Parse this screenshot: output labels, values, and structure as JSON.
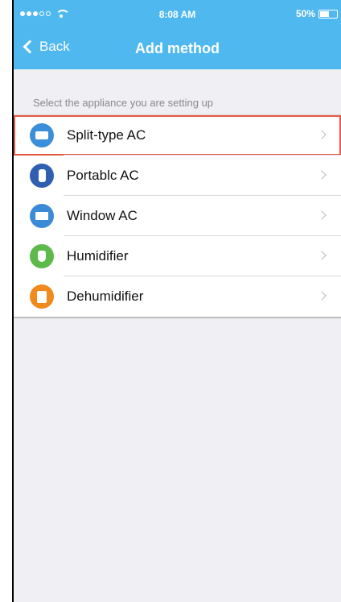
{
  "status_bar": {
    "time": "8:08 AM",
    "battery": "50%",
    "battery_level": 0.5
  },
  "nav": {
    "back_label": "Back",
    "title": "Add method"
  },
  "section_label": "Select the appliance you are setting up",
  "colors": {
    "header": "#4fb8ef",
    "selected_border": "#e45a48"
  },
  "appliances": [
    {
      "label": "Split-type AC",
      "icon": "split-ac-icon",
      "color": "#3b8fd9",
      "selected": true
    },
    {
      "label": "Portablc AC",
      "icon": "portable-ac-icon",
      "color": "#2e5fb0",
      "selected": false
    },
    {
      "label": "Window AC",
      "icon": "window-ac-icon",
      "color": "#3a8ad6",
      "selected": false
    },
    {
      "label": "Humidifier",
      "icon": "humidifier-icon",
      "color": "#5cb94a",
      "selected": false
    },
    {
      "label": "Dehumidifier",
      "icon": "dehumidifier-icon",
      "color": "#f08a1e",
      "selected": false
    }
  ]
}
